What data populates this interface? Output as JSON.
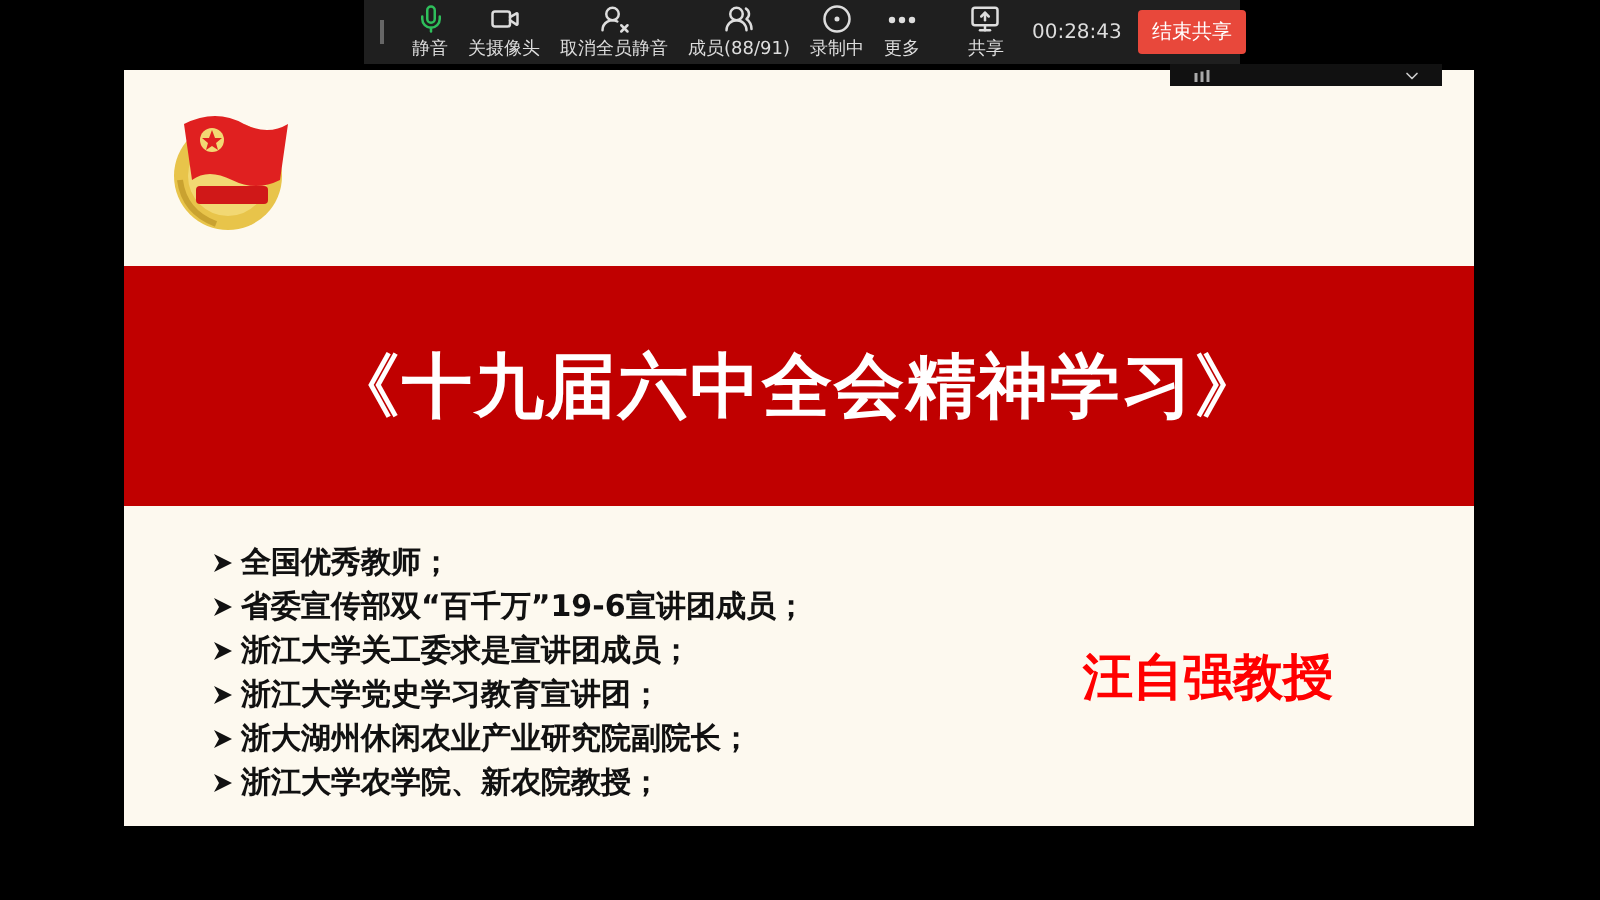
{
  "toolbar": {
    "items": [
      {
        "kind": "mic",
        "label": "静音"
      },
      {
        "kind": "camera",
        "label": "关摄像头"
      },
      {
        "kind": "unmute-all",
        "label": "取消全员静音"
      },
      {
        "kind": "members",
        "label": "成员(88/91)"
      },
      {
        "kind": "record",
        "label": "录制中"
      },
      {
        "kind": "more",
        "label": "更多"
      },
      {
        "kind": "share",
        "label": "共享"
      }
    ],
    "timer": "00:28:43",
    "end_button": "结束共享"
  },
  "slide": {
    "title": "《十九届六中全会精神学习》",
    "bullets": [
      "全国优秀教师；",
      "省委宣传部双“百千万”19-6宣讲团成员；",
      "浙江大学关工委求是宣讲团成员；",
      "浙江大学党史学习教育宣讲团；",
      "浙大湖州休闲农业产业研究院副院长；",
      "浙江大学农学院、新农院教授；"
    ],
    "speaker": "汪自强教授"
  }
}
